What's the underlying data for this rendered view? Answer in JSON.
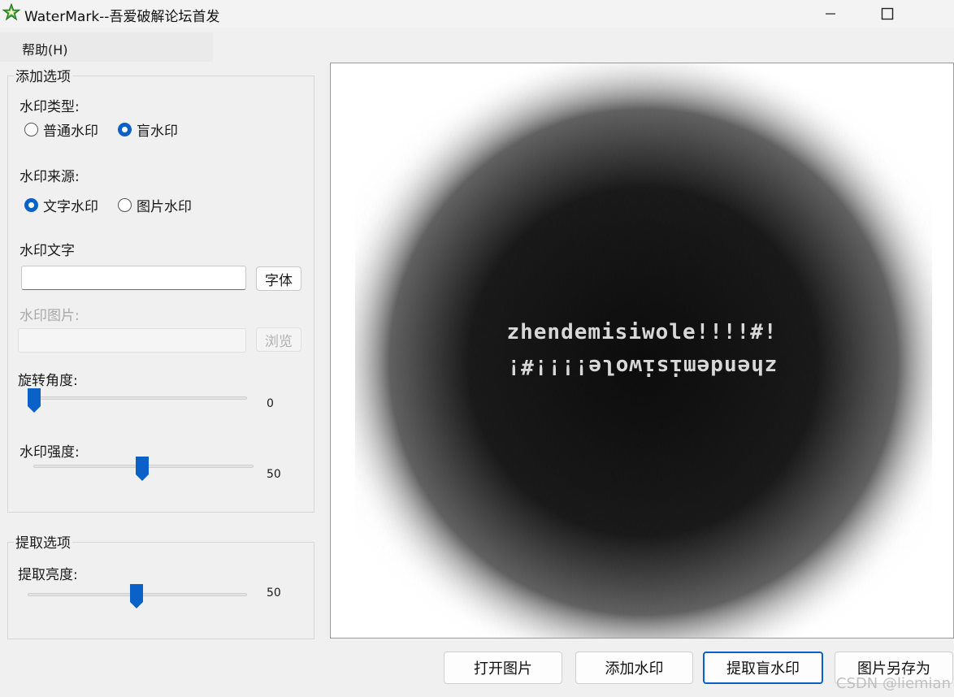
{
  "window": {
    "title": "WaterMark--吾爱破解论坛首发"
  },
  "menu": {
    "help": "帮助(H)"
  },
  "add_options": {
    "group_title": "添加选项",
    "type_label": "水印类型:",
    "type_options": [
      {
        "label": "普通水印",
        "selected": false
      },
      {
        "label": "盲水印",
        "selected": true
      }
    ],
    "source_label": "水印来源:",
    "source_options": [
      {
        "label": "文字水印",
        "selected": true
      },
      {
        "label": "图片水印",
        "selected": false
      }
    ],
    "text_label": "水印文字",
    "text_value": "",
    "font_button": "字体",
    "image_label": "水印图片:",
    "image_value": "",
    "browse_button": "浏览",
    "rotation_label": "旋转角度:",
    "rotation_value": "0",
    "strength_label": "水印强度:",
    "strength_value": "50"
  },
  "extract_options": {
    "group_title": "提取选项",
    "brightness_label": "提取亮度:",
    "brightness_value": "50"
  },
  "preview": {
    "text_line_1": "zhendemisiwole!!!!#!",
    "text_line_2": "zhendemisiwole!!!!#!"
  },
  "buttons": {
    "open": "打开图片",
    "add": "添加水印",
    "extract": "提取盲水印",
    "save_as": "图片另存为"
  },
  "credit": "CSDN @liemian",
  "colors": {
    "accent": "#0a62c9",
    "app_icon_green": "#3aa83a"
  },
  "icons": {
    "app": "star-icon",
    "minimize": "minimize-icon",
    "maximize": "maximize-icon"
  }
}
